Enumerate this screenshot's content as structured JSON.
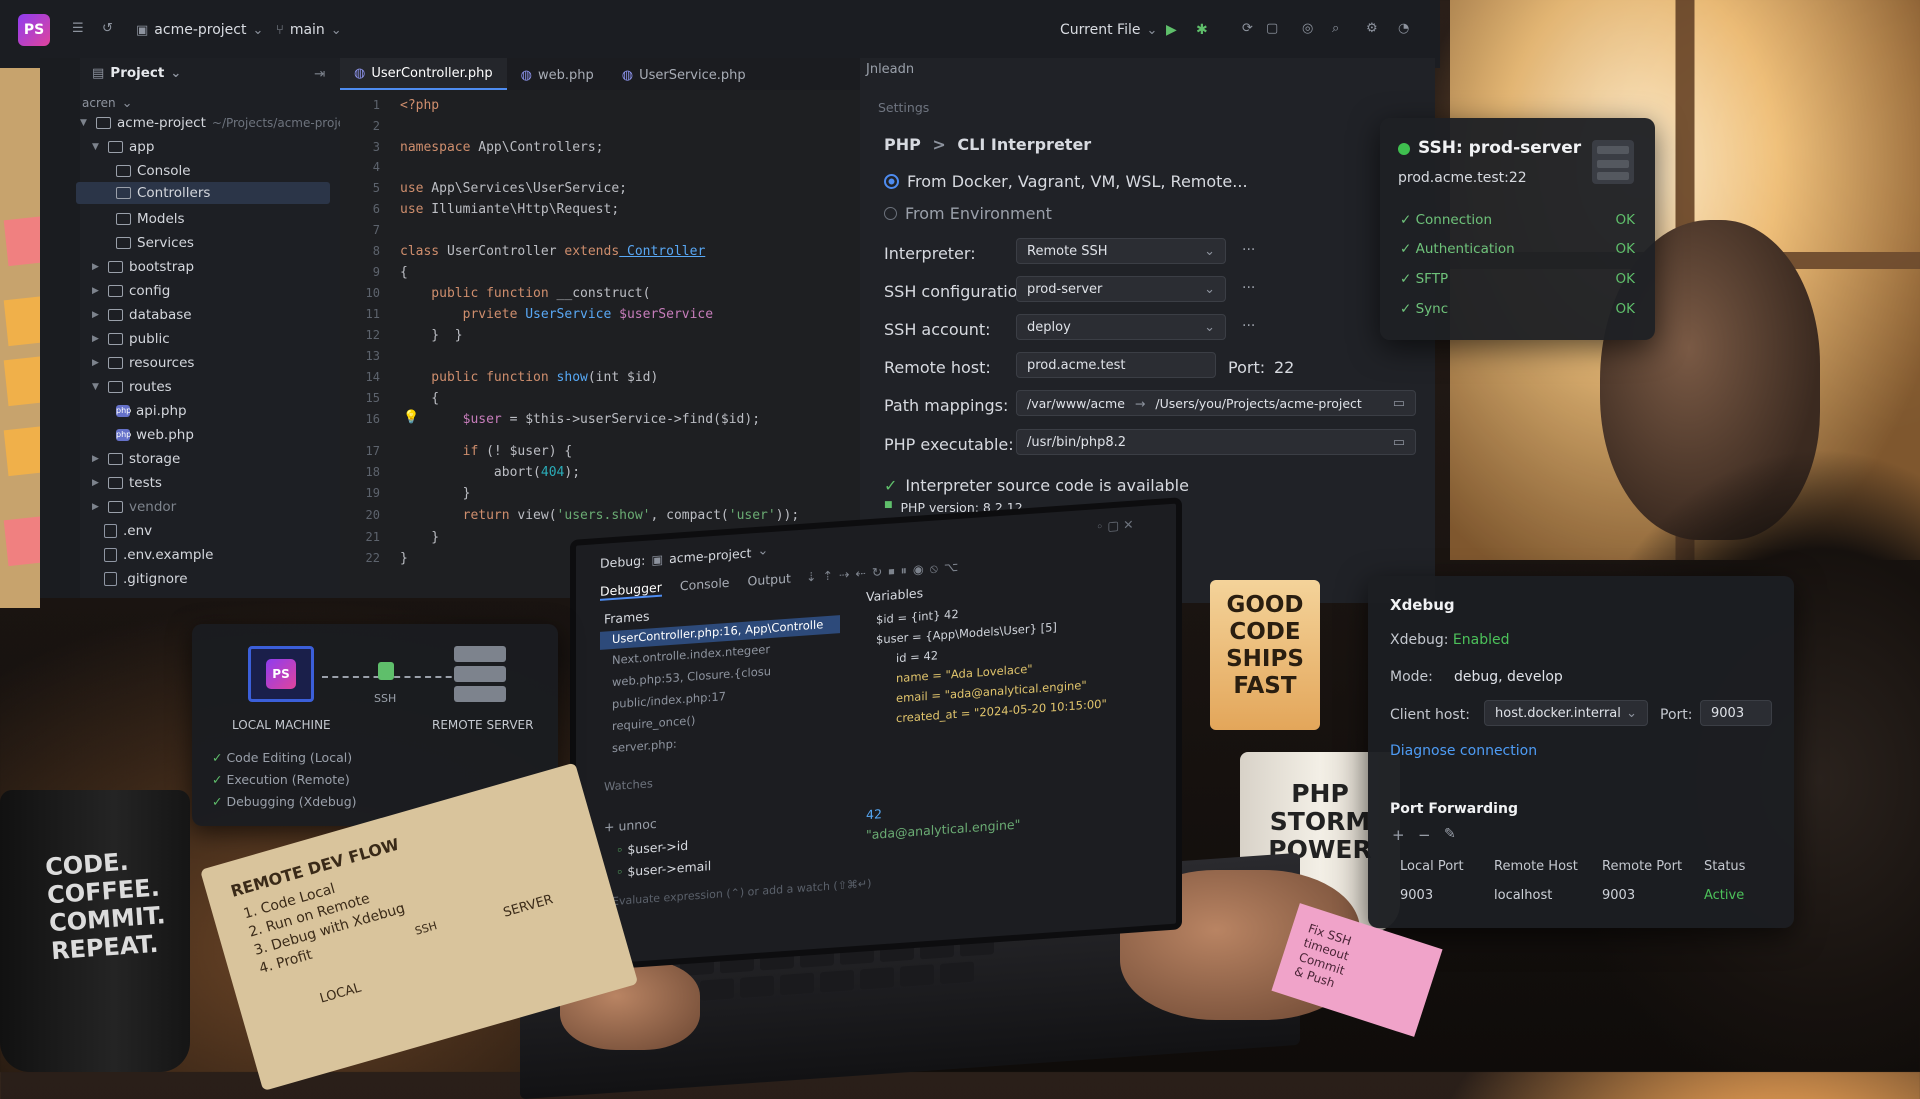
{
  "titlebar": {
    "logo": "PS",
    "project": "acme-project",
    "branch": "main",
    "run_config": "Current File"
  },
  "project_pane": {
    "title": "Project",
    "header_text": "acren",
    "root": "acme-project",
    "root_path": "~/Projects/acme-project",
    "items": [
      {
        "label": "app"
      },
      {
        "label": "Console"
      },
      {
        "label": "Controllers"
      },
      {
        "label": "Models"
      },
      {
        "label": "Services"
      },
      {
        "label": "bootstrap"
      },
      {
        "label": "config"
      },
      {
        "label": "database"
      },
      {
        "label": "public"
      },
      {
        "label": "resources"
      },
      {
        "label": "routes"
      },
      {
        "label": "api.php"
      },
      {
        "label": "web.php"
      },
      {
        "label": "storage"
      },
      {
        "label": "tests"
      },
      {
        "label": "vendor"
      },
      {
        "label": ".env"
      },
      {
        "label": ".env.example"
      },
      {
        "label": ".gitignore"
      }
    ]
  },
  "editor": {
    "tabs": [
      {
        "label": "UserController.php"
      },
      {
        "label": "web.php"
      },
      {
        "label": "UserService.php"
      }
    ],
    "line_numbers": [
      "1",
      "2",
      "3",
      "4",
      "5",
      "6",
      "7",
      "8",
      "9",
      "10",
      "11",
      "12",
      "13",
      "14",
      "15",
      "16",
      "17",
      "18",
      "19",
      "20",
      "21",
      "22"
    ],
    "code": {
      "l1": "<?php",
      "l3_kw": "namespace",
      "l3_rest": " App\\Controllers;",
      "l5_kw": "use",
      "l5_rest": " App\\Services\\UserService;",
      "l6_kw": "use",
      "l6_rest": " Illumiante\\Http\\Request;",
      "l8_kw": "class",
      "l8_name": " UserController ",
      "l8_kw2": "extends",
      "l8_parent": " Controller",
      "l9": "{",
      "l10_kw": "    public function",
      "l10_rest": " __construct(",
      "l11_kw": "        prviete",
      "l11_ty": " UserService",
      "l11_var": " $userService",
      "l12": "    }  }",
      "l14_kw": "    public function",
      "l14_fn": " show",
      "l14_rest": "(int $id)",
      "l15": "    {",
      "l16_var": "        $user",
      "l16_rest": " = $this->userService->find($id);",
      "l17_kw": "        if",
      "l17_rest": " (! $user) {",
      "l18_rest": "            abort(",
      "l18_num": "404",
      "l18_end": ");",
      "l19": "        }",
      "l20_kw": "        return",
      "l20_rest": " view(",
      "l20_str": "'users.show'",
      "l20_rest2": ", compact(",
      "l20_str2": "'user'",
      "l20_end": "));",
      "l21": "    }",
      "l22": "}"
    }
  },
  "settings": {
    "header": "Settings",
    "tab_label": "Jnleadn",
    "breadcrumb_a": "PHP",
    "breadcrumb_sep": ">",
    "breadcrumb_b": "CLI Interpreter",
    "radio1": "From Docker, Vagrant, VM, WSL, Remote...",
    "radio2": "From Environment",
    "interpreter_label": "Interpreter:",
    "interpreter_value": "Remote SSH",
    "sshconf_label": "SSH configuration:",
    "sshconf_value": "prod-server",
    "sshacct_label": "SSH account:",
    "sshacct_value": "deploy",
    "remotehost_label": "Remote host:",
    "remotehost_value": "prod.acme.test",
    "port_label": "Port:",
    "port_value": "22",
    "pathmap_label": "Path mappings:",
    "pathmap_remote": "/var/www/acme",
    "pathmap_arrow": "→",
    "pathmap_local": "/Users/you/Projects/acme-project",
    "phpexe_label": "PHP executable:",
    "phpexe_value": "/usr/bin/php8.2",
    "source_ok": "Interpreter source code is available",
    "php_version": "PHP version: 8.2.12",
    "dots": "···"
  },
  "ssh_panel": {
    "title": "SSH: prod-server",
    "host": "prod.acme.test:22",
    "checks": [
      {
        "label": "Connection",
        "status": "OK"
      },
      {
        "label": "Authentication",
        "status": "OK"
      },
      {
        "label": "SFTP",
        "status": "OK"
      },
      {
        "label": "Sync",
        "status": "OK"
      }
    ],
    "status_color": "#3fbf4f"
  },
  "xdebug": {
    "title": "Xdebug",
    "status_label": "Xdebug:",
    "status_value": "Enabled",
    "mode_label": "Mode:",
    "mode_value": "debug, develop",
    "client_label": "Client host:",
    "client_value": "host.docker.interral",
    "port_label": "Port:",
    "port_value": "9003",
    "diagnose": "Diagnose connection",
    "pf_title": "Port Forwarding",
    "pf_headers": [
      "Local Port",
      "Remote Host",
      "Remote Port",
      "Status"
    ],
    "pf_row": [
      "9003",
      "localhost",
      "9003",
      "Active"
    ],
    "link_color": "#4e9cf5",
    "active_color": "#4cc15a"
  },
  "remote_card": {
    "logo": "PS",
    "local_label": "LOCAL MACHINE",
    "ssh_label": "SSH",
    "remote_label": "REMOTE SERVER",
    "features": [
      "Code Editing (Local)",
      "Execution (Remote)",
      "Debugging (Xdebug)"
    ]
  },
  "debugger": {
    "title": "Debug:",
    "project": "acme-project",
    "tabs": [
      "Debugger",
      "Console",
      "Output"
    ],
    "frames_title": "Frames",
    "frames": [
      "UserController.php:16, App\\Controlle",
      "Next.ontrolle.index.ntegeer",
      "web.php:53, Closure.{closu",
      "public/index.php:17",
      "require_once()",
      "server.php:"
    ],
    "variables_title": "Variables",
    "variables": [
      "$id = {int} 42",
      "$user = {App\\Models\\User} [5]",
      "id = 42",
      "name = \"Ada Lovelace\"",
      "email = \"ada@analytical.engine\"",
      "created_at = \"2024-05-20 10:15:00\""
    ],
    "watches_title": "Watches",
    "watch_add": "+ unnoc",
    "watches": [
      "$user->id",
      "$user->email"
    ],
    "watch_values": [
      "42",
      "\"ada@analytical.engine\""
    ],
    "evaluate": "Evaluate expression (⌃) or add a watch (⇧⌘↵)"
  },
  "props": {
    "mug1_text": [
      "CODE.",
      "COFFEE.",
      "COMMIT.",
      "REPEAT."
    ],
    "lamp_text": [
      "GOOD",
      "CODE",
      "SHIPS",
      "FAST"
    ],
    "mug2_text": [
      "PHP",
      "STORM",
      "POWER"
    ],
    "notebook_title": "REMOTE DEV FLOW",
    "notebook_steps": [
      "1. Code Local",
      "2. Run on Remote",
      "3. Debug with Xdebug",
      "4. Profit"
    ],
    "notebook_local": "LOCAL",
    "notebook_ssh": "SSH",
    "notebook_server": "SERVER",
    "sticky_text": [
      "Fix SSH",
      "timeout",
      "Commit",
      "& Push"
    ]
  }
}
